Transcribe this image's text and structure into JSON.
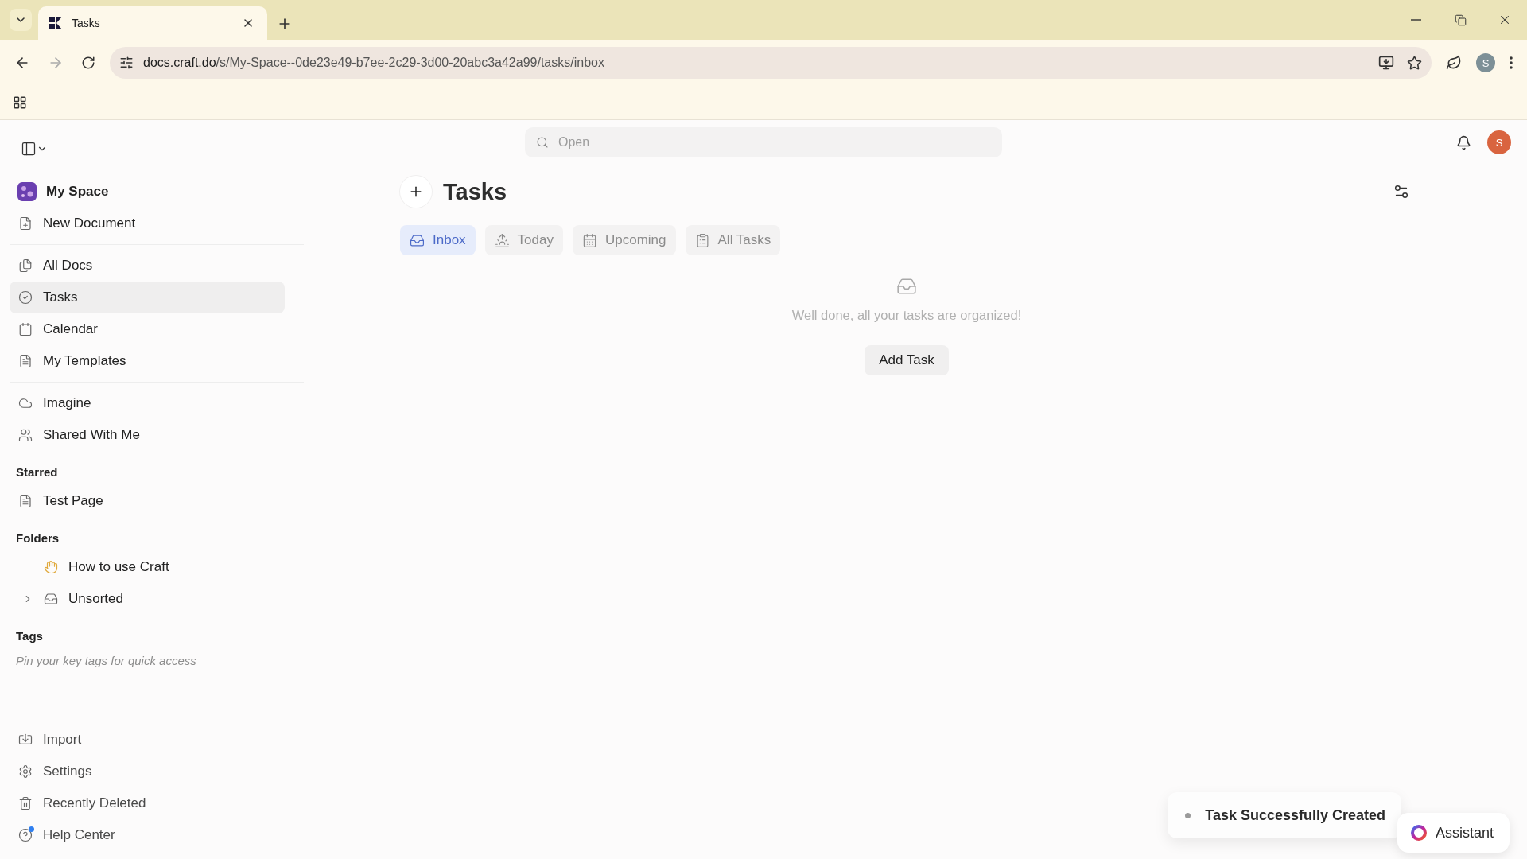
{
  "browser": {
    "tabs": [
      {
        "title": "Tasks",
        "selected": true
      }
    ],
    "url_host": "docs.craft.do",
    "url_path": "/s/My-Space--0de23e49-b7ee-2c29-3d00-20abc3a42a99/tasks/inbox",
    "profile_initial": "S"
  },
  "topbar": {
    "search": {
      "placeholder": "Open"
    },
    "user_initial": "S"
  },
  "sidebar": {
    "workspace": "My Space",
    "primary": [
      {
        "label": "New Document"
      }
    ],
    "nav": [
      {
        "label": "All Docs",
        "selected": false
      },
      {
        "label": "Tasks",
        "selected": true
      },
      {
        "label": "Calendar",
        "selected": false
      },
      {
        "label": "My Templates",
        "selected": false
      }
    ],
    "extra": [
      {
        "label": "Imagine"
      },
      {
        "label": "Shared With Me"
      }
    ],
    "starred": {
      "heading": "Starred",
      "items": [
        {
          "label": "Test Page"
        }
      ]
    },
    "folders": {
      "heading": "Folders",
      "items": [
        {
          "label": "How to use Craft",
          "kind": "emoji"
        },
        {
          "label": "Unsorted",
          "kind": "folder",
          "expanded": false
        }
      ]
    },
    "tags": {
      "heading": "Tags",
      "hint": "Pin your key tags for quick access"
    },
    "footer": [
      {
        "label": "Import",
        "notification": false
      },
      {
        "label": "Settings",
        "notification": false
      },
      {
        "label": "Recently Deleted",
        "notification": false
      },
      {
        "label": "Help Center",
        "notification": true
      }
    ]
  },
  "page": {
    "title": "Tasks",
    "tabs": [
      {
        "label": "Inbox",
        "selected": true
      },
      {
        "label": "Today",
        "selected": false
      },
      {
        "label": "Upcoming",
        "selected": false
      },
      {
        "label": "All Tasks",
        "selected": false
      }
    ],
    "empty_state": {
      "message": "Well done, all your tasks are organized!",
      "button": "Add Task"
    }
  },
  "toast": {
    "message": "Task Successfully Created"
  },
  "assistant": {
    "label": "Assistant"
  }
}
